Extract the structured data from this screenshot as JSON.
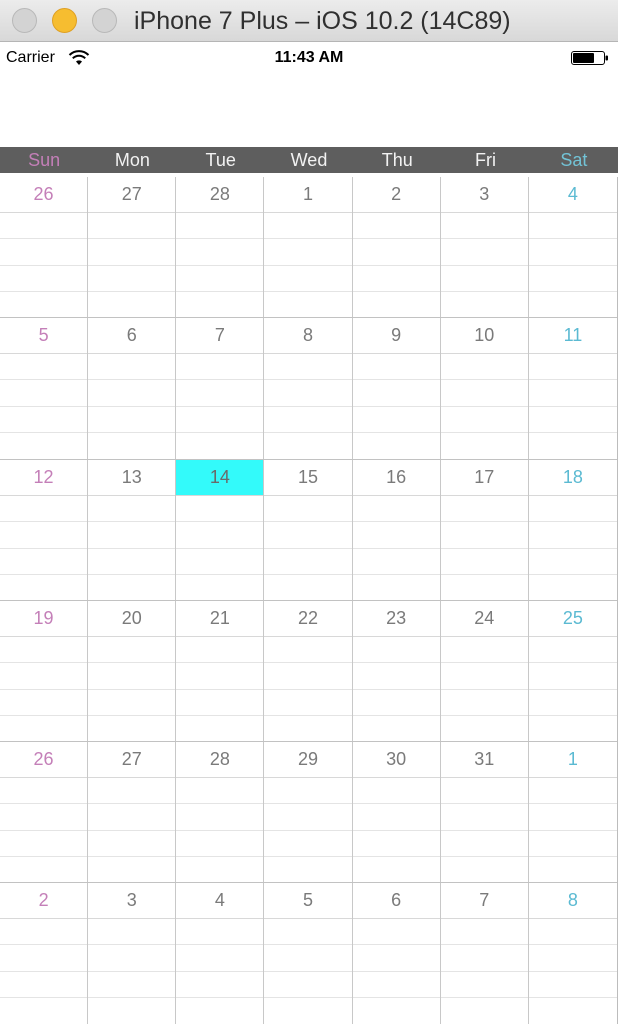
{
  "window": {
    "title": "iPhone 7 Plus – iOS 10.2 (14C89)"
  },
  "status_bar": {
    "carrier": "Carrier",
    "time": "11:43 AM",
    "wifi_icon": "wifi-icon",
    "battery_icon": "battery-icon"
  },
  "weekdays": [
    "Sun",
    "Mon",
    "Tue",
    "Wed",
    "Thu",
    "Fri",
    "Sat"
  ],
  "colors": {
    "sunday": "#c47fb8",
    "saturday": "#5bbad2",
    "today_highlight": "#33fafa",
    "header_bg": "#5e5e5e"
  },
  "today": "14",
  "weeks": [
    [
      "26",
      "27",
      "28",
      "1",
      "2",
      "3",
      "4"
    ],
    [
      "5",
      "6",
      "7",
      "8",
      "9",
      "10",
      "11"
    ],
    [
      "12",
      "13",
      "14",
      "15",
      "16",
      "17",
      "18"
    ],
    [
      "19",
      "20",
      "21",
      "22",
      "23",
      "24",
      "25"
    ],
    [
      "26",
      "27",
      "28",
      "29",
      "30",
      "31",
      "1"
    ],
    [
      "2",
      "3",
      "4",
      "5",
      "6",
      "7",
      "8"
    ]
  ]
}
